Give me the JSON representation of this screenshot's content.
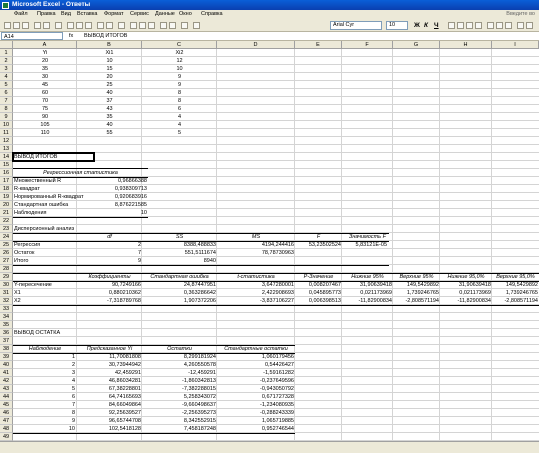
{
  "window": {
    "title": "Microsoft Excel - Ответы"
  },
  "menu": {
    "items": [
      "Файл",
      "Правка",
      "Вид",
      "Вставка",
      "Формат",
      "Сервис",
      "Данные",
      "Окно",
      "Справка"
    ],
    "help_hint": "Введите во"
  },
  "toolbar": {
    "font_name": "Arial Cyr",
    "font_size": "10",
    "bold": "Ж",
    "italic": "К",
    "underline": "Ч"
  },
  "formula_bar": {
    "name_box": "A14",
    "fx": "fx",
    "content": "ВЫВОД ИТОГОВ"
  },
  "columns": [
    "A",
    "B",
    "C",
    "D",
    "E",
    "F",
    "G",
    "H",
    "I"
  ],
  "rows": [
    "1",
    "2",
    "3",
    "4",
    "5",
    "6",
    "7",
    "8",
    "9",
    "10",
    "11",
    "12",
    "13",
    "14",
    "15",
    "16",
    "17",
    "18",
    "19",
    "20",
    "21",
    "22",
    "23",
    "24",
    "25",
    "26",
    "27",
    "28",
    "29",
    "30",
    "31",
    "32",
    "33",
    "34",
    "35",
    "36",
    "37",
    "38",
    "39",
    "40",
    "41",
    "42",
    "43",
    "44",
    "45",
    "46",
    "47",
    "48",
    "49"
  ],
  "input": {
    "headers": [
      "Yi",
      "Xi1",
      "Xi2"
    ],
    "rows": [
      [
        "20",
        "10",
        "12"
      ],
      [
        "35",
        "15",
        "10"
      ],
      [
        "30",
        "20",
        "9"
      ],
      [
        "45",
        "25",
        "9"
      ],
      [
        "60",
        "40",
        "8"
      ],
      [
        "70",
        "37",
        "8"
      ],
      [
        "75",
        "43",
        "6"
      ],
      [
        "90",
        "35",
        "4"
      ],
      [
        "105",
        "40",
        "4"
      ],
      [
        "110",
        "55",
        "5"
      ]
    ]
  },
  "summary": {
    "title": "ВЫВОД ИТОГОВ",
    "regression_stats_header": "Регрессионная статистика",
    "stats": [
      {
        "label": "Множественный R",
        "value": "0,96866388"
      },
      {
        "label": "R-квадрат",
        "value": "0,938309713"
      },
      {
        "label": "Нормированный R-квадрат",
        "value": "0,920683916"
      },
      {
        "label": "Стандартная ошибка",
        "value": "8,876221585"
      },
      {
        "label": "Наблюдения",
        "value": "10"
      }
    ]
  },
  "anova": {
    "title": "Дисперсионный анализ",
    "headers": [
      "df",
      "SS",
      "MS",
      "F",
      "Значимость F"
    ],
    "rows": [
      {
        "label": "Регрессия",
        "df": "2",
        "ss": "8388,488833",
        "ms": "4194,244416",
        "f": "53,23502524",
        "sig": "5,83121E-05"
      },
      {
        "label": "Остаток",
        "df": "7",
        "ss": "551,5111674",
        "ms": "78,78730963",
        "f": "",
        "sig": ""
      },
      {
        "label": "Итого",
        "df": "9",
        "ss": "8940",
        "ms": "",
        "f": "",
        "sig": ""
      }
    ]
  },
  "coefficients": {
    "headers": [
      "Коэффициенты",
      "Стандартная ошибка",
      "t-статистика",
      "P-Значение",
      "Нижние 95%",
      "Верхние 95%",
      "Нижние 95,0%",
      "Верхние 95,0%"
    ],
    "rows": [
      {
        "label": "Y-пересечение",
        "values": [
          "90,7249166",
          "24,87447951",
          "3,647280001",
          "0,008207467",
          "31,90639418",
          "149,5429892",
          "31,90639418",
          "149,5429892"
        ]
      },
      {
        "label": "X1",
        "values": [
          "0,880210362",
          "0,363286642",
          "2,422908693",
          "0,045895773",
          "0,021173969",
          "1,739246765",
          "0,021173969",
          "1,739246765"
        ]
      },
      {
        "label": "X2",
        "values": [
          "-7,318789768",
          "1,907372206",
          "-3,837106227",
          "0,006398513",
          "-11,82900834",
          "-2,808571194",
          "-11,82900834",
          "-2,808571194"
        ]
      }
    ]
  },
  "residuals": {
    "title": "ВЫВОД ОСТАТКА",
    "headers": [
      "Наблюдение",
      "Предсказанное Yi",
      "Остатки",
      "Стандартные остатки"
    ],
    "rows": [
      [
        "1",
        "11,70081808",
        "8,299181924",
        "1,060179456"
      ],
      [
        "2",
        "30,73944942",
        "4,260550578",
        "0,54426427"
      ],
      [
        "3",
        "42,459291",
        "-12,459291",
        "-1,59161282"
      ],
      [
        "4",
        "46,86034281",
        "-1,860342813",
        "-0,237649596"
      ],
      [
        "5",
        "67,38228801",
        "-7,382288015",
        "-0,943050792"
      ],
      [
        "6",
        "64,74165693",
        "5,258343072",
        "0,671727328"
      ],
      [
        "7",
        "84,66049864",
        "-9,660498637",
        "-1,234080935"
      ],
      [
        "8",
        "92,25639527",
        "-2,256395273",
        "-0,288243339"
      ],
      [
        "9",
        "96,65744708",
        "8,342552915",
        "1,065719885"
      ],
      [
        "10",
        "102,5418128",
        "7,458187248",
        "0,952746544"
      ]
    ]
  }
}
